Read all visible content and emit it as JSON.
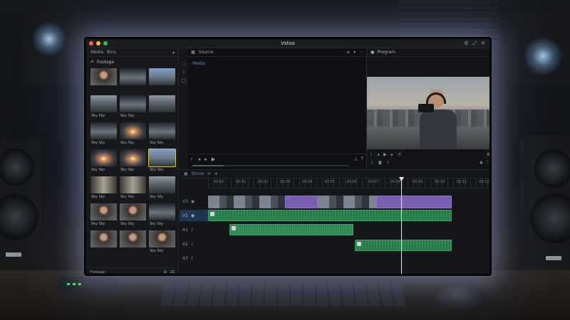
{
  "app": {
    "title": "Vstoa",
    "window_dots": [
      "#ff5f57",
      "#febc2e",
      "#28c840"
    ],
    "title_icons": [
      "gear-icon",
      "expand-icon",
      "close-icon"
    ]
  },
  "media_browser": {
    "tabs": [
      "Media",
      "Bins"
    ],
    "header_label": "Footage",
    "footer_label": "Footage",
    "items": [
      {
        "label": "",
        "style": "t-person"
      },
      {
        "label": "",
        "style": "t-road"
      },
      {
        "label": "",
        "style": "t-city"
      },
      {
        "label": "Sky Sky",
        "style": "t-street"
      },
      {
        "label": "Sky Sky",
        "style": "t-road"
      },
      {
        "label": "",
        "style": "t-street"
      },
      {
        "label": "Sky Sky",
        "style": "t-road"
      },
      {
        "label": "Sky Sky",
        "style": "t-sunset"
      },
      {
        "label": "Sky Sky",
        "style": "t-road"
      },
      {
        "label": "Sky Sky",
        "style": "t-sunset"
      },
      {
        "label": "Sky Sky",
        "style": "t-sunset"
      },
      {
        "label": "Sky Sky",
        "style": "t-city"
      },
      {
        "label": "Sky Sky",
        "style": "t-alley"
      },
      {
        "label": "Sky Sky",
        "style": "t-alley"
      },
      {
        "label": "Sky Sky",
        "style": "t-street"
      },
      {
        "label": "Sky Sky",
        "style": "t-person"
      },
      {
        "label": "Sky Sky",
        "style": "t-person"
      },
      {
        "label": "Sky Sky",
        "style": "t-road"
      },
      {
        "label": "",
        "style": "t-person"
      },
      {
        "label": "",
        "style": "t-person"
      },
      {
        "label": "Sky Sky",
        "style": "t-person"
      }
    ],
    "selected_index": 11
  },
  "source_viewer": {
    "tab_label": "Source",
    "clip_label": "Media"
  },
  "program_viewer": {
    "tab_label": "Program"
  },
  "timeline": {
    "sequence_tab": "Stone",
    "track_labels": [
      "V3",
      "V1",
      "A1",
      "A2",
      "A3"
    ],
    "ruler_ticks": [
      "00:00",
      "00:01",
      "00:02",
      "00:03",
      "00:04",
      "00:05",
      "00:06",
      "00:07",
      "00:08",
      "00:09",
      "00:10",
      "00:11",
      "00:12"
    ]
  },
  "colors": {
    "accent_blue": "#5c8fcf",
    "audio_green": "#2f8c54",
    "clip_purple": "#7a5fb0",
    "glow": "#bec8ff"
  }
}
